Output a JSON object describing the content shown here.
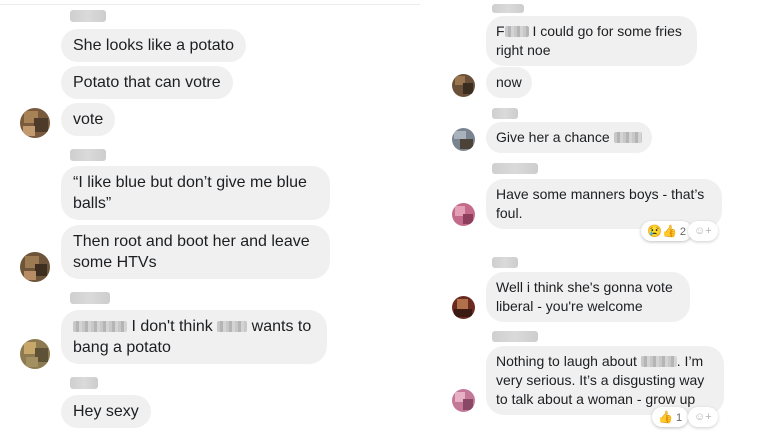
{
  "left": {
    "messages": [
      {
        "text": "She looks like a potato"
      },
      {
        "text": "Potato that can votre"
      },
      {
        "text": "vote"
      },
      {
        "text": "“I like blue but don’t give me blue\nballs”"
      },
      {
        "text": "Then root and boot her and leave\nsome HTVs"
      },
      {
        "pre": "",
        "mid": " I don't think ",
        "post": " wants to\nbang a potato"
      },
      {
        "text": "Hey sexy"
      }
    ]
  },
  "right": {
    "messages": [
      {
        "pre": "F",
        "post": " I could go for some fries\nright noe"
      },
      {
        "text": "now"
      },
      {
        "pre": "Give her a chance ",
        "post": ""
      },
      {
        "text": "Have some manners boys - that’s\nfoul."
      },
      {
        "text": "Well i think she's gonna vote\nliberal - you're welcome"
      },
      {
        "pre": "Nothing to laugh about ",
        "post": ". I’m\nvery serious. It’s a disgusting way\nto talk about a woman - grow up"
      }
    ],
    "reactions": [
      {
        "emoji": "😢👍",
        "count": "2"
      },
      {
        "emoji": "👍",
        "count": "1"
      }
    ],
    "add_reaction": "☺+"
  }
}
